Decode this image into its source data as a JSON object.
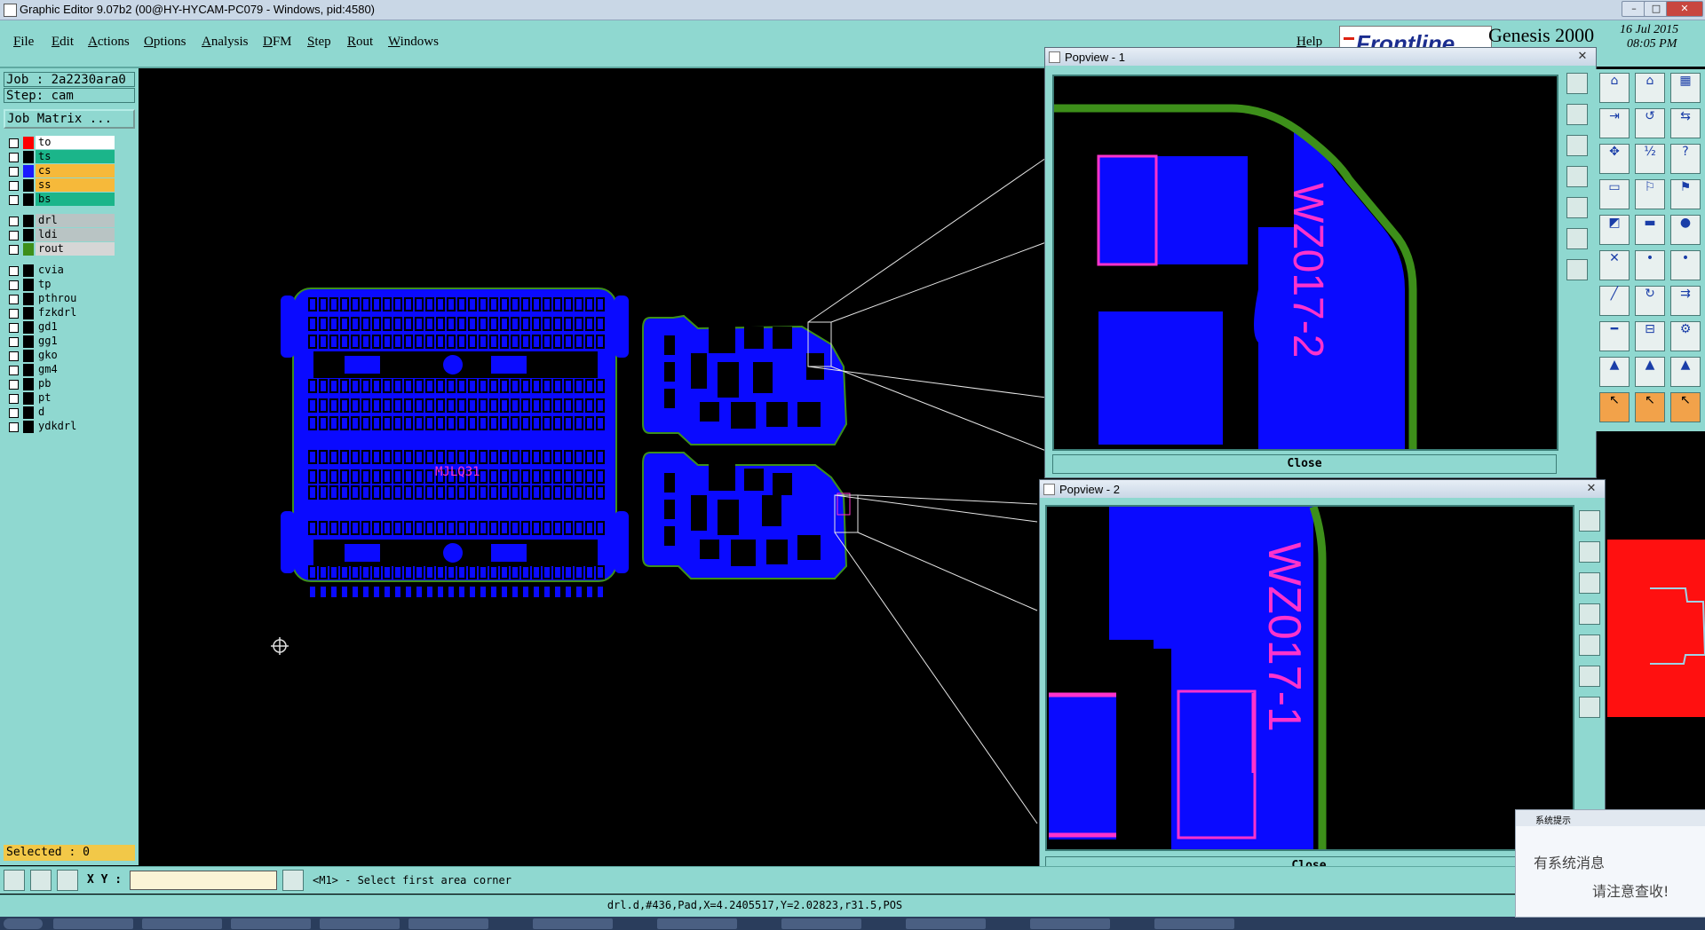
{
  "window": {
    "title": "Graphic Editor 9.07b2 (00@HY-HYCAM-PC079 - Windows, pid:4580)",
    "minimize": "–",
    "maximize": "□",
    "close": "✕"
  },
  "menu": {
    "items": [
      "File",
      "Edit",
      "Actions",
      "Options",
      "Analysis",
      "DFM",
      "Step",
      "Rout",
      "Windows"
    ],
    "help": "Help"
  },
  "brand": {
    "logo": "Frontline",
    "product": "Genesis 2000",
    "date": "16 Jul 2015",
    "time": "08:05 PM"
  },
  "left": {
    "job": "Job : 2a2230ara0",
    "step": "Step: cam",
    "job_matrix": "Job Matrix ...",
    "layers_group1": [
      {
        "name": "to",
        "color": "#ff0000",
        "bg": "#ffffff"
      },
      {
        "name": "ts",
        "color": "#000000",
        "bg": "#1bb58a"
      },
      {
        "name": "cs",
        "color": "#1a1aff",
        "bg": "#f6b93a"
      },
      {
        "name": "ss",
        "color": "#000000",
        "bg": "#f6b93a"
      },
      {
        "name": "bs",
        "color": "#000000",
        "bg": "#1bb58a"
      }
    ],
    "layers_group2": [
      {
        "name": "drl",
        "color": "#000000",
        "bg": "#b9c4c4"
      },
      {
        "name": "ldi",
        "color": "#000000",
        "bg": "#b9c4c4"
      },
      {
        "name": "rout",
        "color": "#3d8f1a",
        "bg": "#d6d6d6"
      }
    ],
    "layers_group3": [
      {
        "name": "cvia",
        "color": "#000000",
        "bg": "#8fd8d0"
      },
      {
        "name": "tp",
        "color": "#000000",
        "bg": "#8fd8d0"
      },
      {
        "name": "pthrou",
        "color": "#000000",
        "bg": "#8fd8d0"
      },
      {
        "name": "fzkdrl",
        "color": "#000000",
        "bg": "#8fd8d0"
      },
      {
        "name": "gd1",
        "color": "#000000",
        "bg": "#8fd8d0"
      },
      {
        "name": "gg1",
        "color": "#000000",
        "bg": "#8fd8d0"
      },
      {
        "name": "gko",
        "color": "#000000",
        "bg": "#8fd8d0"
      },
      {
        "name": "gm4",
        "color": "#000000",
        "bg": "#8fd8d0"
      },
      {
        "name": "pb",
        "color": "#000000",
        "bg": "#8fd8d0"
      },
      {
        "name": "pt",
        "color": "#000000",
        "bg": "#8fd8d0"
      },
      {
        "name": "d",
        "color": "#000000",
        "bg": "#8fd8d0"
      },
      {
        "name": "ydkdrl",
        "color": "#000000",
        "bg": "#8fd8d0"
      }
    ],
    "selected": "Selected : 0"
  },
  "bottom": {
    "xy_label": "X Y :",
    "xy_value": "",
    "prompt": "<M1> - Select first area corner"
  },
  "status": "drl.d,#436,Pad,X=4.2405517,Y=2.02823,r31.5,POS",
  "canvas": {
    "board_label": "MJLQ31",
    "copper_color": "#0a0aff",
    "outline_color": "#3d8f1a",
    "marking_color": "#ff33cc"
  },
  "popview1": {
    "title": "Popview - 1",
    "label": "WZ017-2",
    "close": "Close"
  },
  "popview2": {
    "title": "Popview - 2",
    "label": "WZ017-1",
    "close": "Close"
  },
  "sysmsg": {
    "title": "系统提示",
    "line1": "有系统消息",
    "line2": "请注意查收!"
  }
}
